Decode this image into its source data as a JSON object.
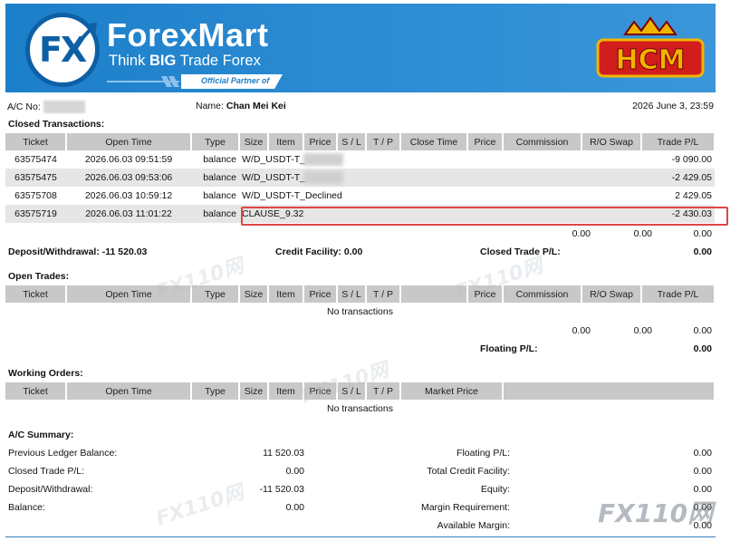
{
  "header": {
    "brand_name": "ForexMart",
    "tagline_pre": "Think ",
    "tagline_bold": "BIG",
    "tagline_post": " Trade Forex",
    "partner_text": "Official Partner of",
    "partner_logo_text": "HCM",
    "logo_text": "FX"
  },
  "account": {
    "ac_label": "A/C No:",
    "name_label": "Name:",
    "name_value": "Chan Mei Kei",
    "datetime": "2026 June 3, 23:59"
  },
  "closed": {
    "title": "Closed Transactions:",
    "columns": [
      "Ticket",
      "Open Time",
      "Type",
      "Size",
      "Item",
      "Price",
      "S / L",
      "T / P",
      "Close Time",
      "Price",
      "Commission",
      "R/O Swap",
      "Trade P/L"
    ],
    "rows": [
      {
        "ticket": "63575474",
        "open_time": "2026.06.03 09:51:59",
        "type": "balance",
        "item": "W/D_USDT-T_",
        "pl": "-9 090.00"
      },
      {
        "ticket": "63575475",
        "open_time": "2026.06.03 09:53:06",
        "type": "balance",
        "item": "W/D_USDT-T_",
        "pl": "-2 429.05"
      },
      {
        "ticket": "63575708",
        "open_time": "2026.06.03 10:59:12",
        "type": "balance",
        "item": "W/D_USDT-T_Declined",
        "pl": "2 429.05"
      },
      {
        "ticket": "63575719",
        "open_time": "2026.06.03 11:01:22",
        "type": "balance",
        "item": "CLAUSE_9.32",
        "pl": "-2 430.03"
      }
    ],
    "totals": [
      "0.00",
      "0.00",
      "0.00"
    ],
    "deposit_label": "Deposit/Withdrawal:",
    "deposit_value": "-11 520.03",
    "credit_label": "Credit Facility:",
    "credit_value": "0.00",
    "closed_pl_label": "Closed Trade P/L:",
    "closed_pl_value": "0.00"
  },
  "open": {
    "title": "Open Trades:",
    "columns": [
      "Ticket",
      "Open Time",
      "Type",
      "Size",
      "Item",
      "Price",
      "S / L",
      "T / P",
      "",
      "Price",
      "Commission",
      "R/O Swap",
      "Trade P/L"
    ],
    "empty_text": "No transactions",
    "totals": [
      "0.00",
      "0.00",
      "0.00"
    ],
    "floating_label": "Floating P/L:",
    "floating_value": "0.00"
  },
  "working": {
    "title": "Working Orders:",
    "columns": [
      "Ticket",
      "Open Time",
      "Type",
      "Size",
      "Item",
      "Price",
      "S / L",
      "T / P",
      "Market Price",
      ""
    ],
    "empty_text": "No transactions"
  },
  "summary": {
    "title": "A/C Summary:",
    "left": [
      {
        "label": "Previous Ledger Balance:",
        "value": "11 520.03"
      },
      {
        "label": "Closed Trade P/L:",
        "value": "0.00"
      },
      {
        "label": "Deposit/Withdrawal:",
        "value": "-11 520.03"
      },
      {
        "label": "Balance:",
        "value": "0.00"
      }
    ],
    "right": [
      {
        "label": "Floating P/L:",
        "value": "0.00"
      },
      {
        "label": "Total Credit Facility:",
        "value": "0.00"
      },
      {
        "label": "Equity:",
        "value": "0.00"
      },
      {
        "label": "Margin Requirement:",
        "value": "0.00"
      },
      {
        "label": "Available Margin:",
        "value": "0.00"
      }
    ]
  },
  "watermark": "FX110网",
  "colors": {
    "banner": "#1c7fc9",
    "header_cell": "#c8c8c8",
    "highlight": "#e04545"
  }
}
